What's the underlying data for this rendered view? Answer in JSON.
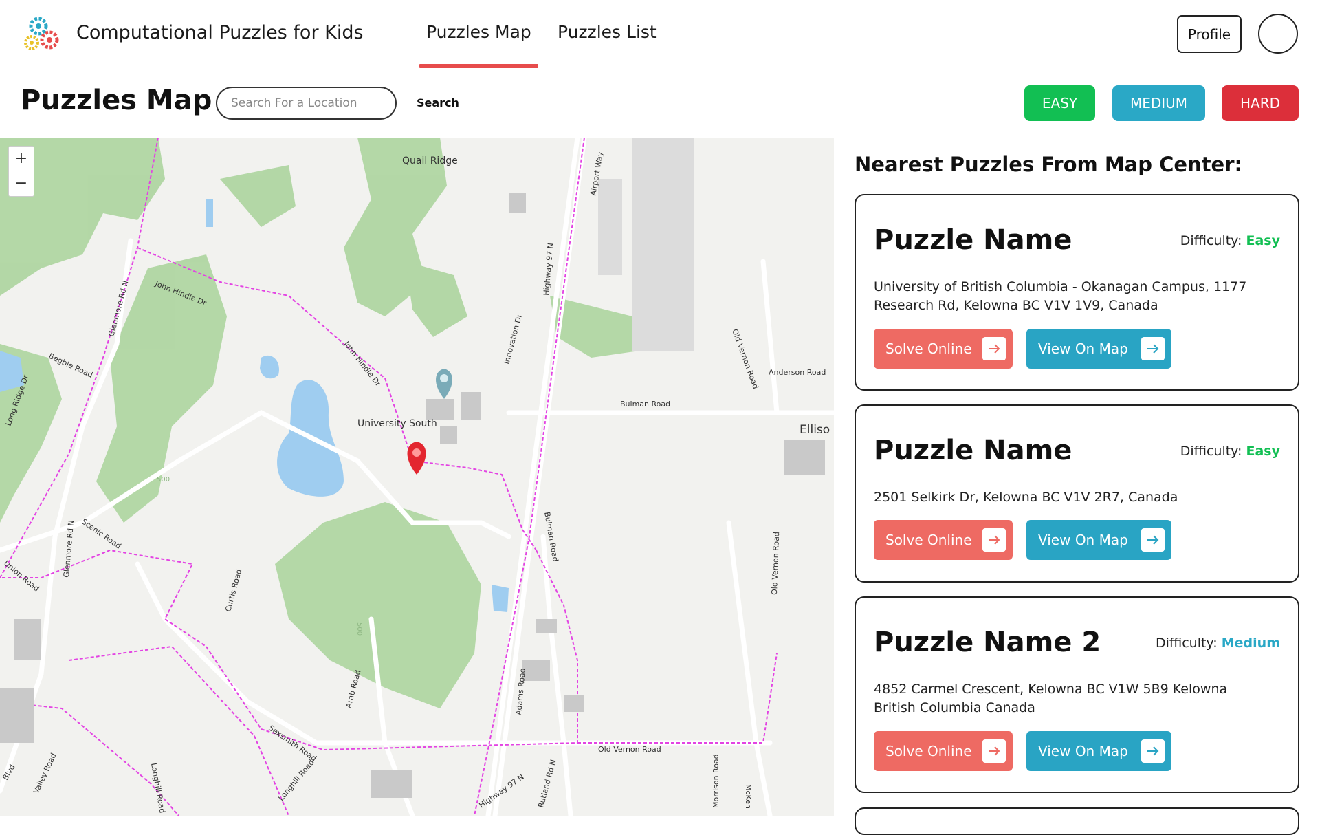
{
  "header": {
    "brand": "Computational Puzzles for Kids",
    "tabs": [
      {
        "label": "Puzzles Map",
        "active": true
      },
      {
        "label": "Puzzles List",
        "active": false
      }
    ],
    "profile_label": "Profile"
  },
  "toolbar": {
    "page_title": "Puzzles Map",
    "search_placeholder": "Search For a Location",
    "search_label": "Search",
    "difficulty_buttons": [
      {
        "label": "EASY",
        "color": "#12bf53"
      },
      {
        "label": "MEDIUM",
        "color": "#2aa8c6"
      },
      {
        "label": "HARD",
        "color": "#dc2f3a"
      }
    ]
  },
  "map": {
    "zoom_in": "+",
    "zoom_out": "−",
    "labels": {
      "quail_ridge": "Quail Ridge",
      "john_hindle_1": "John Hindle Dr",
      "john_hindle_2": "John Hindle Dr",
      "glenmore_1": "Glenmore Rd N",
      "glenmore_2": "Glenmore Rd N",
      "begbie": "Begbie Road",
      "long_ridge": "Long Ridge Dr",
      "university_south": "University South",
      "highway_97": "Highway 97 N",
      "highway_97_2": "Highway 97 N",
      "airport_way": "Airport Way",
      "innovation": "Innovation Dr",
      "bulman_road": "Bulman Road",
      "bulman_road_v": "Bulman Road",
      "old_vernon_1": "Old Vernon Road",
      "old_vernon_2": "Old Vernon Road",
      "old_vernon_3": "Old Vernon Road",
      "anderson": "Anderson Road",
      "ellison": "Elliso",
      "scenic": "Scenic Road",
      "union": "Union Road",
      "curtis": "Curtis Road",
      "sexsmith": "Sexsmith Road",
      "arab": "Arab Road",
      "adams": "Adams Road",
      "valley": "Valley Road",
      "longhill": "Longhill Road",
      "longhill_2": "Longhill Road",
      "rutland": "Rutland Rd N",
      "morrison": "Morrison Road",
      "mckenzie": "McKen",
      "elev_500_1": "500",
      "elev_500_2": "500",
      "blvd": "Blvd"
    }
  },
  "panel": {
    "title": "Nearest Puzzles From Map Center:",
    "difficulty_prefix": "Difficulty:",
    "solve_label": "Solve Online",
    "view_label": "View On Map",
    "puzzles": [
      {
        "name": "Puzzle Name",
        "difficulty": "Easy",
        "difficulty_color": "#12bf53",
        "address": "University of British Columbia - Okanagan Campus, 1177 Research Rd, Kelowna BC V1V 1V9, Canada"
      },
      {
        "name": "Puzzle Name",
        "difficulty": "Easy",
        "difficulty_color": "#12bf53",
        "address": "2501 Selkirk Dr, Kelowna BC V1V 2R7, Canada"
      },
      {
        "name": "Puzzle Name 2",
        "difficulty": "Medium",
        "difficulty_color": "#2aa8c6",
        "address": "4852 Carmel Crescent, Kelowna BC V1W 5B9 Kelowna British Columbia Canada"
      }
    ]
  },
  "colors": {
    "accent_red": "#e74c4c",
    "solve": "#ee6a63",
    "view": "#29a4c4"
  }
}
